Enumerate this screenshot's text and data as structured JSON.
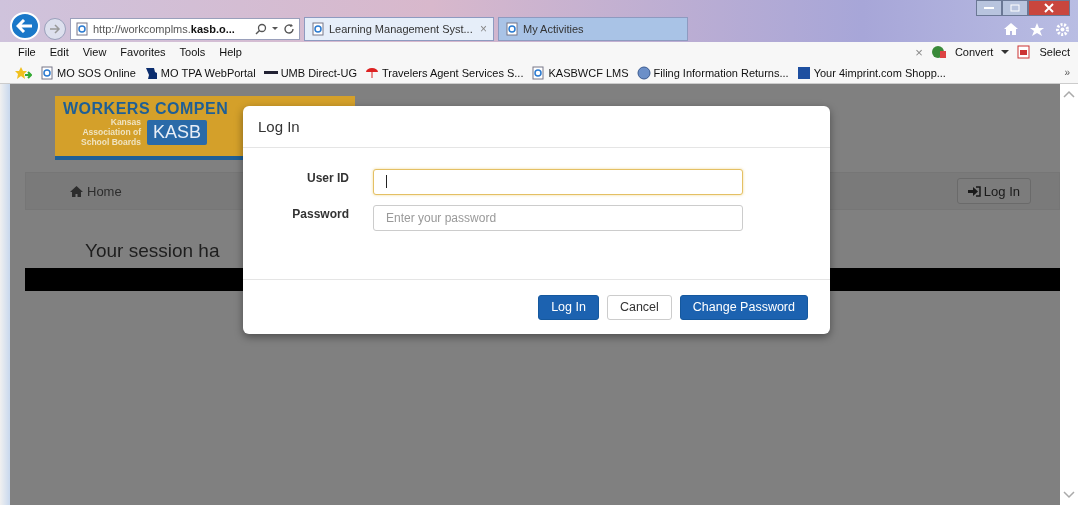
{
  "browser": {
    "address": {
      "plain": "http://workcomplms.",
      "bold": "kasb.o..."
    },
    "tabs": [
      {
        "label": "Learning Management Syst...",
        "selected": true,
        "close": "×"
      },
      {
        "label": "My Activities",
        "selected": false
      }
    ],
    "menu": [
      "File",
      "Edit",
      "View",
      "Favorites",
      "Tools",
      "Help"
    ],
    "command_bar": {
      "close": "×",
      "convert": "Convert",
      "select": "Select"
    },
    "favorites": [
      {
        "label": "MO SOS Online"
      },
      {
        "label": "MO TPA WebPortal"
      },
      {
        "label": "UMB Direct-UG"
      },
      {
        "label": "Travelers Agent Services S..."
      },
      {
        "label": "KASBWCF LMS"
      },
      {
        "label": "Filing Information Returns..."
      },
      {
        "label": "Your 4imprint.com Shopp..."
      }
    ],
    "more": "»"
  },
  "page": {
    "logo": {
      "title": "WORKERS COMPEN",
      "org": "Kansas Association of School Boards",
      "badge": "KASB"
    },
    "nav": {
      "home": "Home",
      "login": "Log In"
    },
    "heading": "Your session ha"
  },
  "modal": {
    "title": "Log In",
    "fields": [
      {
        "label": "User ID",
        "focused": true
      },
      {
        "label": "Password",
        "placeholder": "Enter your password",
        "focused": false
      }
    ],
    "buttons": [
      {
        "label": "Log In",
        "kind": "primary"
      },
      {
        "label": "Cancel",
        "kind": "default"
      },
      {
        "label": "Change Password",
        "kind": "primary"
      }
    ]
  }
}
